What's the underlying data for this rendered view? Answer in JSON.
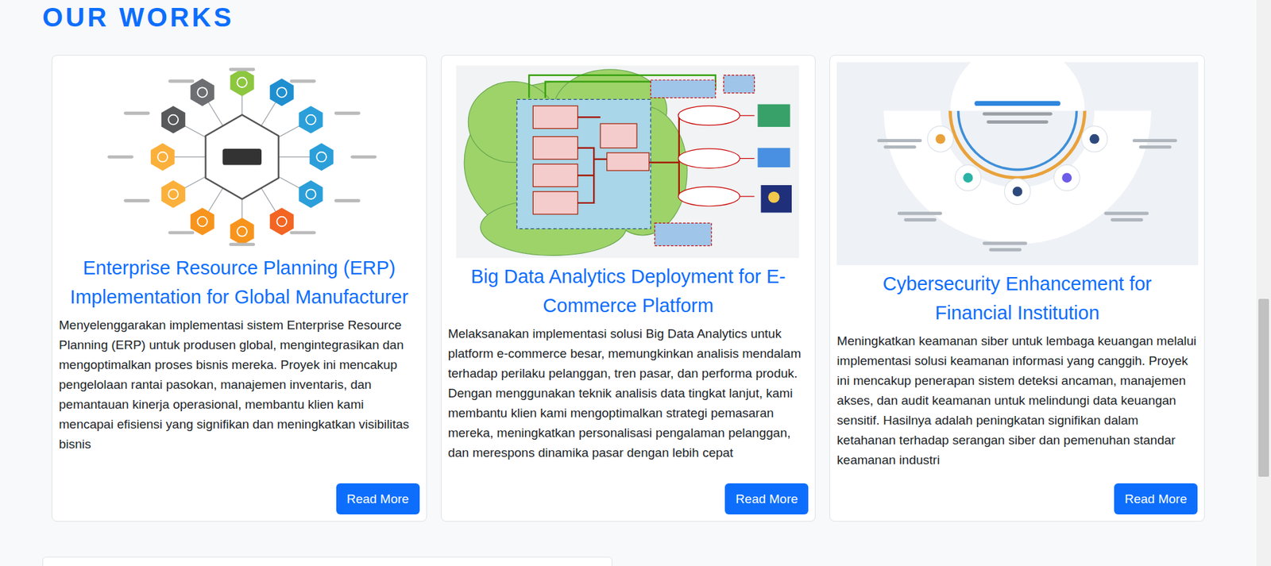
{
  "heading": "OUR WORKS",
  "works": [
    {
      "title": "Enterprise Resource Planning (ERP) Implementation for Global Manufacturer",
      "description": "Menyelenggarakan implementasi sistem Enterprise Resource Planning (ERP) untuk produsen global, mengintegrasikan dan mengoptimalkan proses bisnis mereka. Proyek ini mencakup pengelolaan rantai pasokan, manajemen inventaris, dan pemantauan kinerja operasional, membantu klien kami mencapai efisiensi yang signifikan dan meningkatkan visibilitas bisnis",
      "button": "Read More"
    },
    {
      "title": "Big Data Analytics Deployment for E-Commerce Platform",
      "description": "Melaksanakan implementasi solusi Big Data Analytics untuk platform e-commerce besar, memungkinkan analisis mendalam terhadap perilaku pelanggan, tren pasar, dan performa produk. Dengan menggunakan teknik analisis data tingkat lanjut, kami membantu klien kami mengoptimalkan strategi pemasaran mereka, meningkatkan personalisasi pengalaman pelanggan, dan merespons dinamika pasar dengan lebih cepat",
      "button": "Read More"
    },
    {
      "title": "Cybersecurity Enhancement for Financial Institution",
      "description": "Meningkatkan keamanan siber untuk lembaga keuangan melalui implementasi solusi keamanan informasi yang canggih. Proyek ini mencakup penerapan sistem deteksi ancaman, manajemen akses, dan audit keamanan untuk melindungi data keuangan sensitif. Hasilnya adalah peningkatan signifikan dalam ketahanan terhadap serangan siber dan pemenuhan standar keamanan industri",
      "button": "Read More"
    }
  ],
  "scrollbar": {
    "level": 0.77
  }
}
